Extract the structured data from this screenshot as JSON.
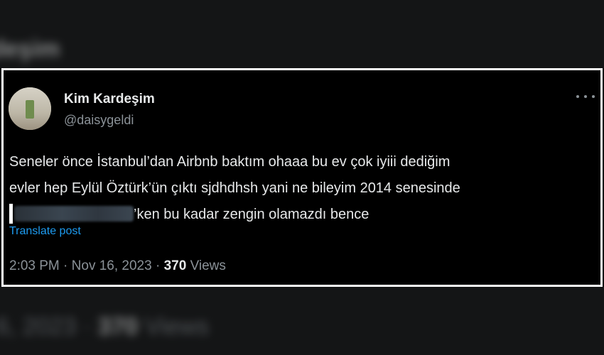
{
  "background": {
    "top_text": "deşim",
    "bottom_date": "6, 2023 ·",
    "bottom_count": "370",
    "bottom_views": "Views"
  },
  "tweet": {
    "display_name": "Kim Kardeşim",
    "handle": "@daisygeldi",
    "text_line_1": "Seneler önce İstanbul’dan Airbnb baktım ohaaa bu ev çok iyiii dediğim",
    "text_line_2": "evler hep Eylül Öztürk’ün çıktı sjdhdhsh yani ne bileyim 2014 senesinde",
    "text_line_3": "’ken bu kadar zengin olamazdı bence",
    "translate_label": "Translate post",
    "time": "2:03 PM",
    "date": "Nov 16, 2023",
    "view_count": "370",
    "views_label": "Views"
  },
  "colors": {
    "background": "#000000",
    "text": "#e7e9ea",
    "secondary": "#8b9298",
    "link": "#1d9bf0"
  },
  "icons": {
    "more": "more-horizontal-icon"
  }
}
